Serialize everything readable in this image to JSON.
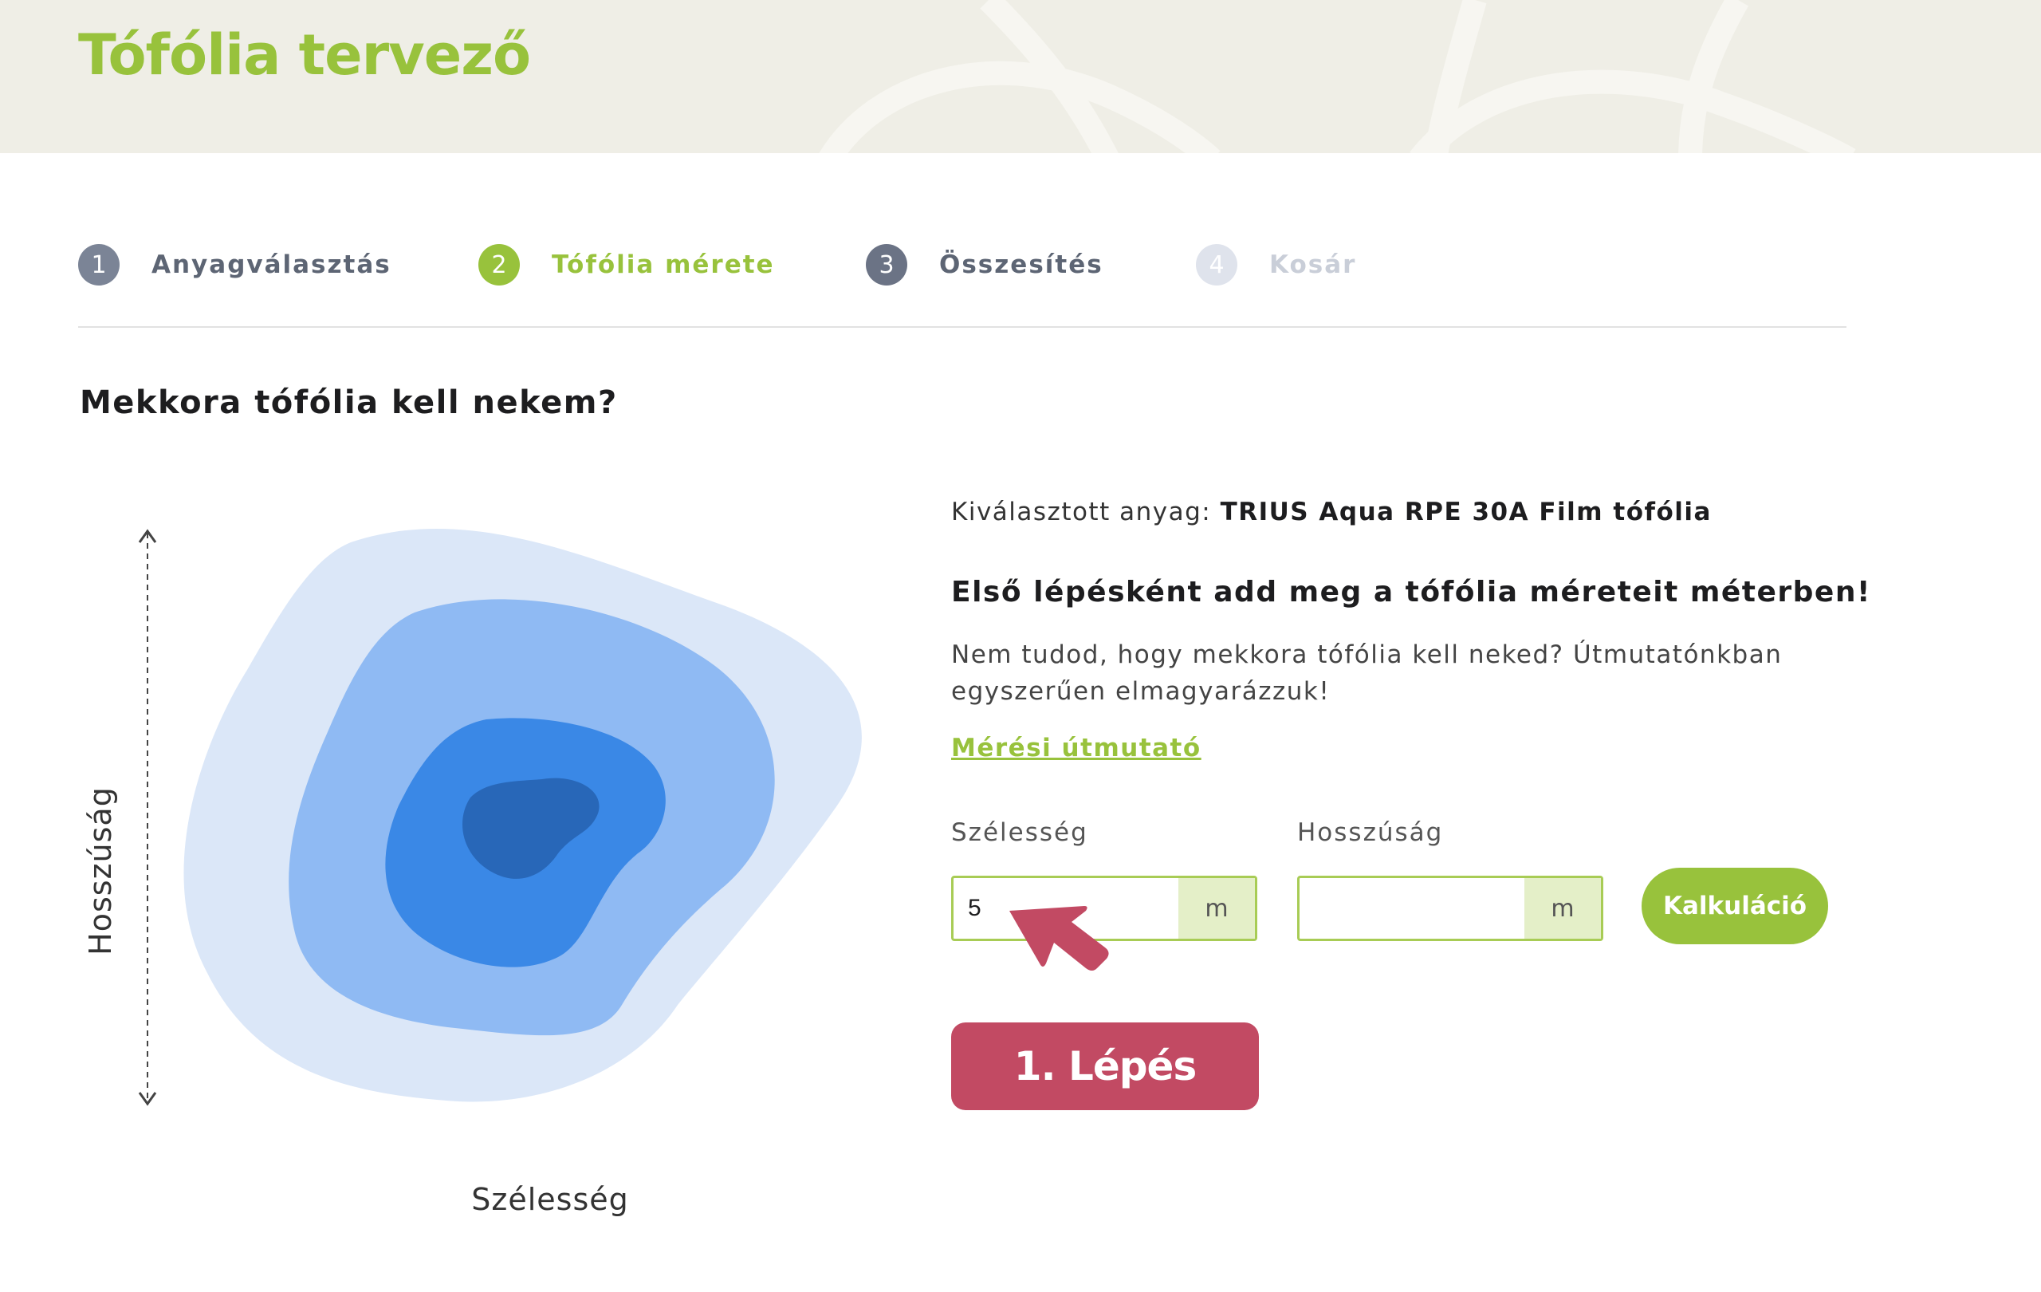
{
  "header": {
    "title": "Tófólia tervező"
  },
  "steps": [
    {
      "number": "1",
      "label": "Anyagválasztás",
      "state": "done"
    },
    {
      "number": "2",
      "label": "Tófólia mérete",
      "state": "active"
    },
    {
      "number": "3",
      "label": "Összesítés",
      "state": "upcoming"
    },
    {
      "number": "4",
      "label": "Kosár",
      "state": "disabled"
    }
  ],
  "main": {
    "heading": "Mekkora tófólia kell nekem?",
    "diagram": {
      "length_label": "Hosszúság",
      "width_label": "Szélesség"
    },
    "material": {
      "prefix": "Kiválasztott anyag:",
      "name": "TRIUS Aqua RPE 30A Film tófólia"
    },
    "instruction_heading": "Első lépésként add meg a tófólia méreteit méterben!",
    "help_text": "Nem tudod, hogy mekkora tófólia kell neked? Útmutatónkban egyszerűen elmagyarázzuk!",
    "guide_link": "Mérési útmutató",
    "width_field": {
      "label": "Szélesség",
      "value": "5",
      "unit": "m"
    },
    "length_field": {
      "label": "Hosszúság",
      "value": "",
      "unit": "m"
    },
    "calc_button": "Kalkuláció"
  },
  "annotation": {
    "step_badge": "1. Lépés"
  },
  "colors": {
    "accent_green": "#98c23c",
    "annotation_red": "#c24a63",
    "header_bg": "#efeee6",
    "pond_layers": [
      "#dbe7f8",
      "#8fbaf3",
      "#3a88e6",
      "#2867b8"
    ]
  },
  "icons": [
    "cursor-arrow-icon"
  ]
}
